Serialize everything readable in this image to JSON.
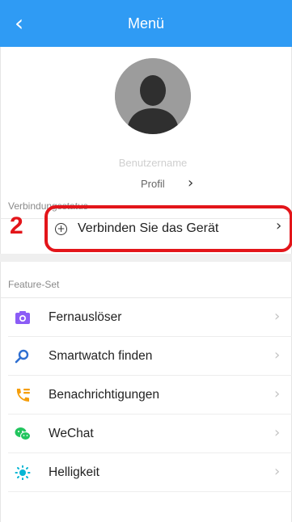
{
  "header": {
    "title": "Menü",
    "back_icon": "chevron-left-icon"
  },
  "profile": {
    "username_placeholder": "Benutzername",
    "profile_label": "Profil"
  },
  "connection": {
    "section_label": "Verbindungsstatus",
    "step_number": "2",
    "connect_label": "Verbinden Sie das Gerät",
    "highlight_color": "#e3151a"
  },
  "features": {
    "section_label": "Feature-Set",
    "items": [
      {
        "label": "Fernauslöser",
        "icon": "camera-icon",
        "color": "#8b5cf6"
      },
      {
        "label": "Smartwatch finden",
        "icon": "search-icon",
        "color": "#2f6fd1"
      },
      {
        "label": "Benachrichtigungen",
        "icon": "phone-notification-icon",
        "color": "#f59e0b"
      },
      {
        "label": "WeChat",
        "icon": "wechat-icon",
        "color": "#22c55e"
      },
      {
        "label": "Helligkeit",
        "icon": "brightness-icon",
        "color": "#06b6d4"
      }
    ]
  },
  "colors": {
    "header": "#2f9bf4"
  }
}
